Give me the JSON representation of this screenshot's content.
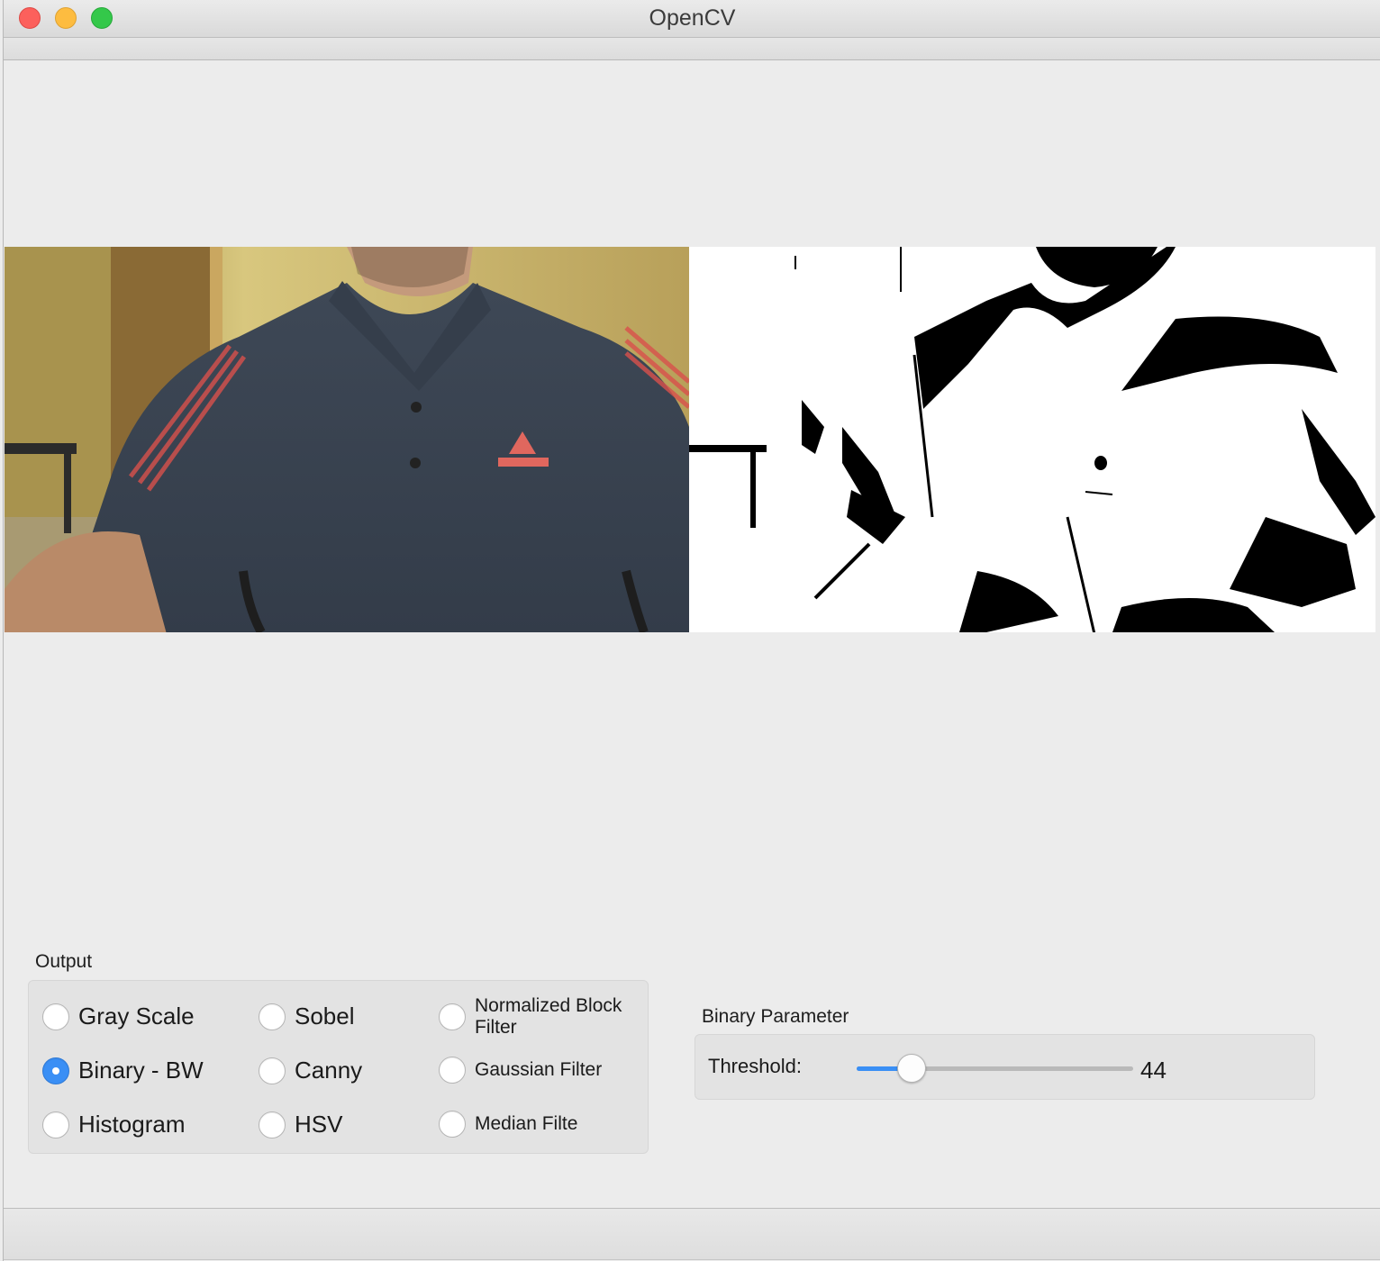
{
  "window": {
    "title": "OpenCV"
  },
  "output": {
    "label": "Output",
    "options": [
      {
        "label": "Gray Scale",
        "checked": false
      },
      {
        "label": "Binary - BW",
        "checked": true
      },
      {
        "label": "Histogram",
        "checked": false
      },
      {
        "label": "Sobel",
        "checked": false
      },
      {
        "label": "Canny",
        "checked": false
      },
      {
        "label": "HSV",
        "checked": false
      },
      {
        "label": "Normalized Block Filter",
        "checked": false
      },
      {
        "label": "Gaussian Filter",
        "checked": false
      },
      {
        "label": "Median Filte",
        "checked": false
      }
    ]
  },
  "binary_parameter": {
    "label": "Binary Parameter",
    "threshold_label": "Threshold:",
    "threshold_value": "44",
    "threshold_fraction": 0.2
  },
  "colors": {
    "accent": "#3a8ff5",
    "shirt": "#3d4755",
    "stripe": "#d9514c",
    "wall": "#c9b46a"
  }
}
